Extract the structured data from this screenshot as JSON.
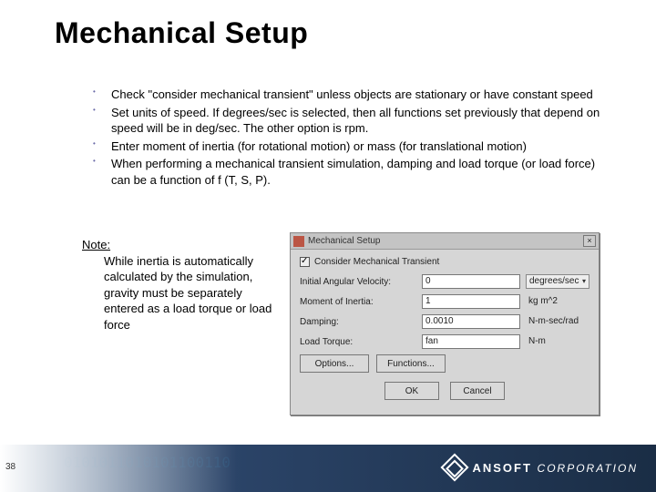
{
  "title": "Mechanical Setup",
  "bullets": [
    "Check \"consider mechanical transient\" unless objects are stationary or have constant speed",
    "Set units of speed. If degrees/sec is selected, then all functions set previously that depend on speed will be in deg/sec. The other option is rpm.",
    "Enter moment of inertia (for rotational motion) or mass (for translational motion)",
    "When performing a mechanical transient simulation, damping and load torque (or load force) can be a function of f (T, S, P)."
  ],
  "note": {
    "label": "Note:",
    "body": "While inertia is automatically calculated by the simulation, gravity must be separately entered as a load torque or load force"
  },
  "dialog": {
    "title": "Mechanical Setup",
    "checkbox_label": "Consider Mechanical Transient",
    "checkbox_checked": true,
    "rows": {
      "r0": {
        "label": "Initial Angular Velocity:",
        "value": "0",
        "unit": "degrees/sec",
        "unit_dropdown": true
      },
      "r1": {
        "label": "Moment of Inertia:",
        "value": "1",
        "unit": "kg m^2",
        "unit_dropdown": false
      },
      "r2": {
        "label": "Damping:",
        "value": "0.0010",
        "unit": "N-m-sec/rad",
        "unit_dropdown": false
      },
      "r3": {
        "label": "Load Torque:",
        "value": "fan",
        "unit": "N-m",
        "unit_dropdown": false
      }
    },
    "buttons": {
      "options": "Options...",
      "functions": "Functions...",
      "ok": "OK",
      "cancel": "Cancel"
    }
  },
  "footer": {
    "digits": "0101011010101100110",
    "brand": "ANSOFT",
    "corp": "CORPORATION"
  },
  "page_number": "38"
}
